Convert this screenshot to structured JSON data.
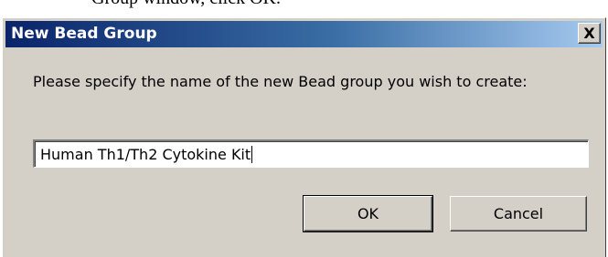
{
  "background_text": "Group window, click OK.",
  "dialog": {
    "title": "New Bead Group",
    "close_glyph": "X",
    "prompt": "Please specify the name of the new Bead group you wish to create:",
    "input_value": "Human Th1/Th2 Cytokine Kit",
    "ok_label": "OK",
    "cancel_label": "Cancel"
  },
  "colors": {
    "dialog_face": "#d4d0c8",
    "titlebar_start": "#0a246a",
    "titlebar_end": "#a6caf0"
  }
}
